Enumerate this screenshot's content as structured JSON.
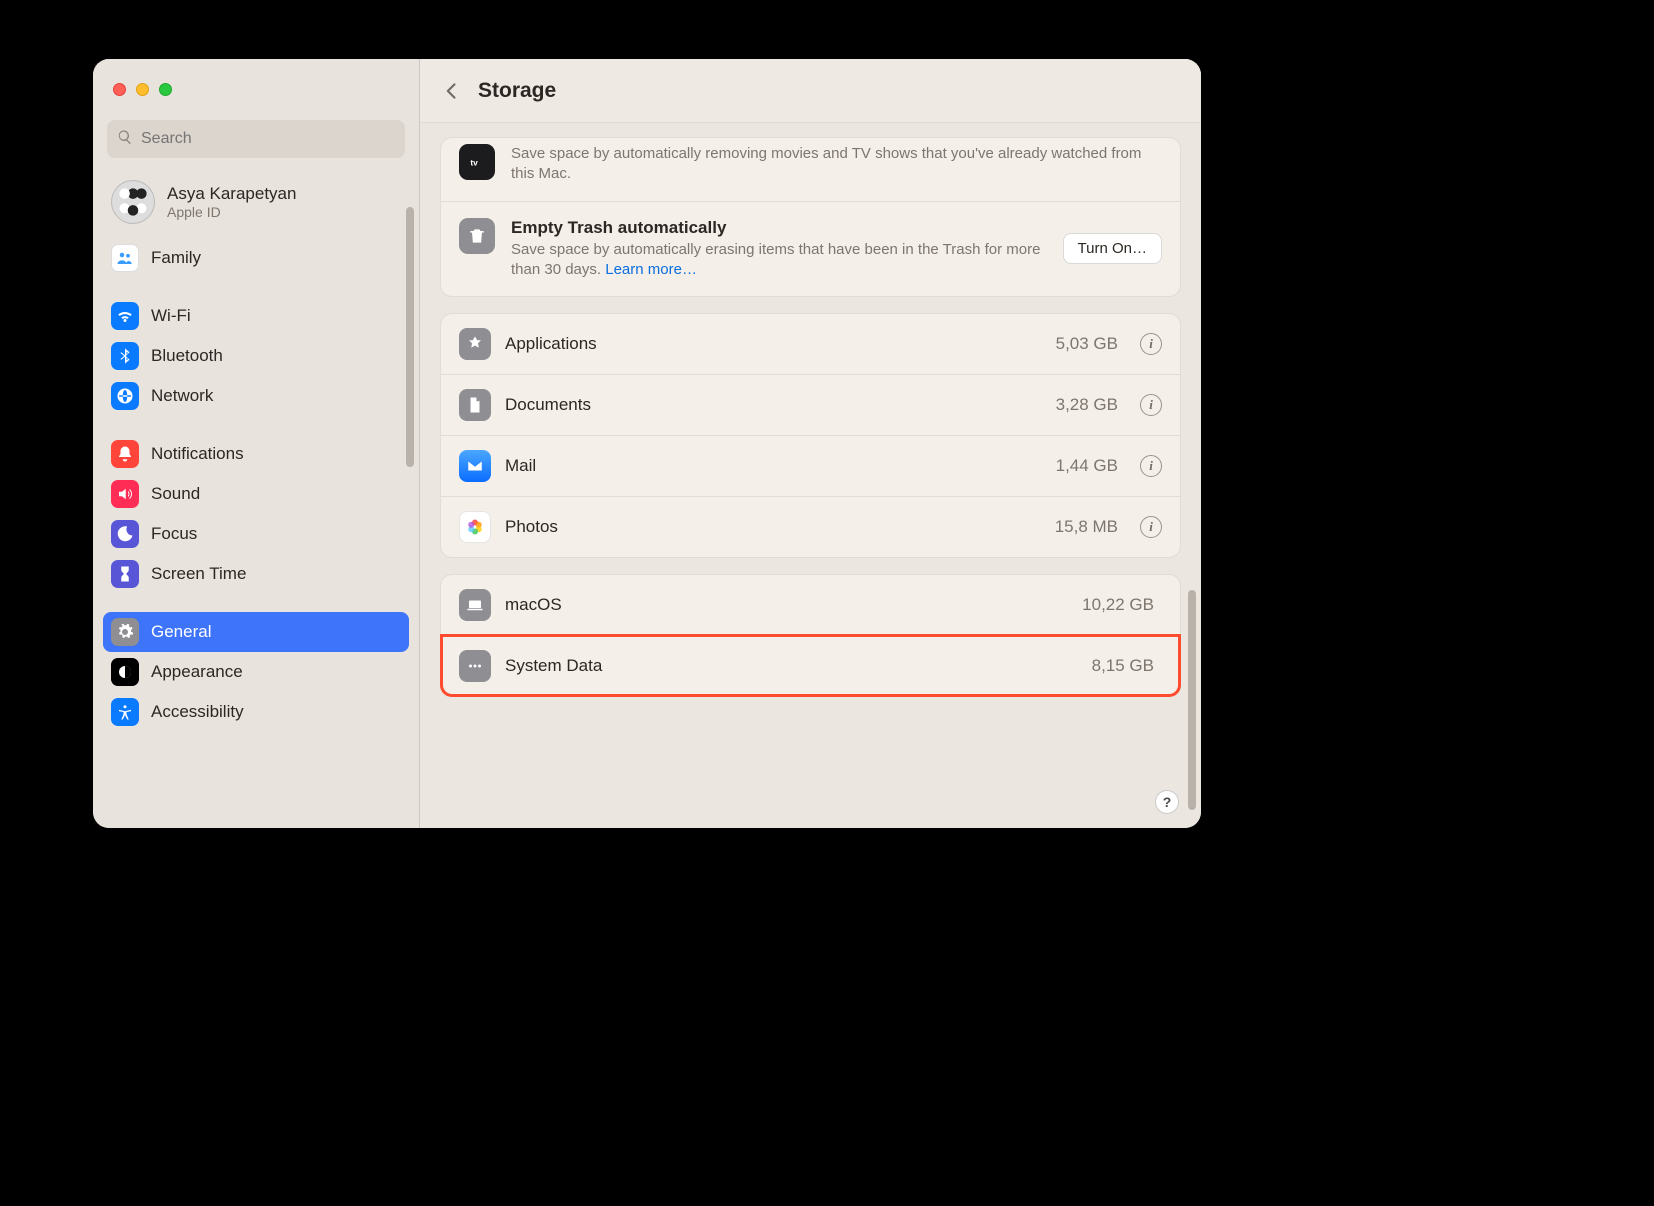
{
  "header": {
    "title": "Storage"
  },
  "search": {
    "placeholder": "Search"
  },
  "account": {
    "name": "Asya Karapetyan",
    "sub": "Apple ID"
  },
  "sidebar": {
    "items": [
      {
        "label": "Family"
      },
      {
        "label": "Wi-Fi"
      },
      {
        "label": "Bluetooth"
      },
      {
        "label": "Network"
      },
      {
        "label": "Notifications"
      },
      {
        "label": "Sound"
      },
      {
        "label": "Focus"
      },
      {
        "label": "Screen Time"
      },
      {
        "label": "General"
      },
      {
        "label": "Appearance"
      },
      {
        "label": "Accessibility"
      }
    ]
  },
  "recommendations": {
    "tv": {
      "desc": "Save space by automatically removing movies and TV shows that you've already watched from this Mac."
    },
    "trash": {
      "title": "Empty Trash automatically",
      "desc_prefix": "Save space by automatically erasing items that have been in the Trash for more than 30 days. ",
      "learn_more": "Learn more…",
      "button": "Turn On…"
    }
  },
  "categories": [
    {
      "label": "Applications",
      "size": "5,03 GB"
    },
    {
      "label": "Documents",
      "size": "3,28 GB"
    },
    {
      "label": "Mail",
      "size": "1,44 GB"
    },
    {
      "label": "Photos",
      "size": "15,8 MB"
    }
  ],
  "system": {
    "macos": {
      "label": "macOS",
      "size": "10,22 GB"
    },
    "sysdata": {
      "label": "System Data",
      "size": "8,15 GB"
    }
  },
  "help": "?"
}
